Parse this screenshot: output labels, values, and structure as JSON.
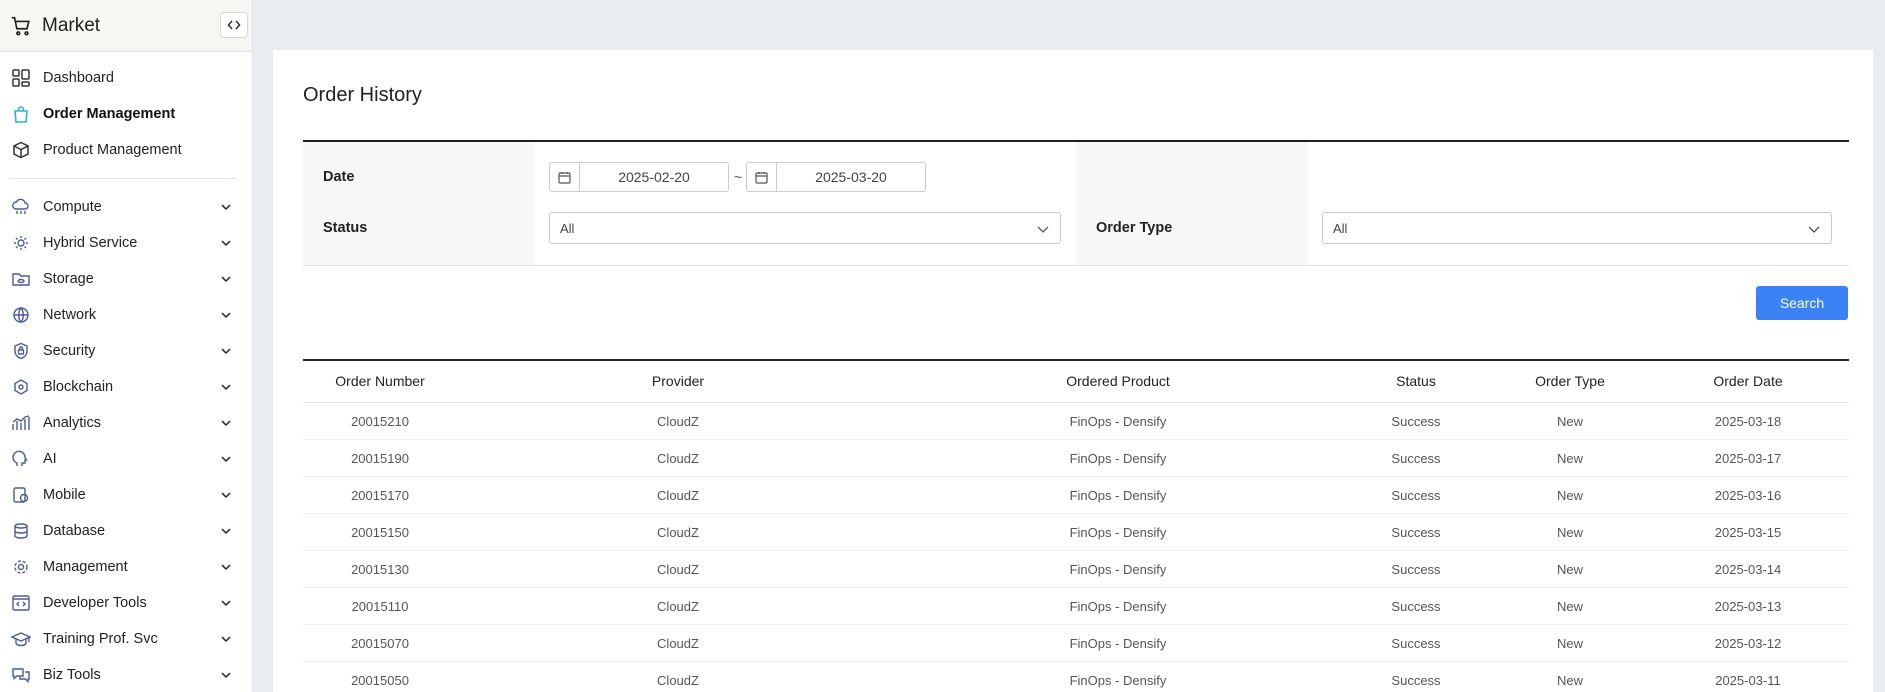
{
  "brand": {
    "title": "Market"
  },
  "nav_top": [
    {
      "label": "Dashboard",
      "icon": "dashboard-grid-icon"
    },
    {
      "label": "Order Management",
      "icon": "shopping-bag-icon",
      "active": true
    },
    {
      "label": "Product Management",
      "icon": "box-icon"
    }
  ],
  "nav_groups": [
    {
      "label": "Compute",
      "icon": "cloud-compute-icon"
    },
    {
      "label": "Hybrid Service",
      "icon": "hybrid-gear-icon"
    },
    {
      "label": "Storage",
      "icon": "storage-icon"
    },
    {
      "label": "Network",
      "icon": "network-icon"
    },
    {
      "label": "Security",
      "icon": "shield-icon"
    },
    {
      "label": "Blockchain",
      "icon": "blockchain-icon"
    },
    {
      "label": "Analytics",
      "icon": "analytics-icon"
    },
    {
      "label": "AI",
      "icon": "ai-head-icon"
    },
    {
      "label": "Mobile",
      "icon": "mobile-icon"
    },
    {
      "label": "Database",
      "icon": "database-icon"
    },
    {
      "label": "Management",
      "icon": "management-gear-icon"
    },
    {
      "label": "Developer Tools",
      "icon": "developer-tools-icon"
    },
    {
      "label": "Training Prof. Svc",
      "icon": "graduation-cap-icon"
    },
    {
      "label": "Biz Tools",
      "icon": "chat-bubbles-icon"
    }
  ],
  "page": {
    "title": "Order History"
  },
  "filter": {
    "date_label": "Date",
    "date_from": "2025-02-20",
    "date_separator": "~",
    "date_to": "2025-03-20",
    "status_label": "Status",
    "status_value": "All",
    "order_type_label": "Order Type",
    "order_type_value": "All",
    "search_label": "Search"
  },
  "table": {
    "headers": [
      "Order Number",
      "Provider",
      "Ordered Product",
      "Status",
      "Order Type",
      "Order Date"
    ],
    "rows": [
      [
        "20015210",
        "CloudZ",
        "FinOps - Densify",
        "Success",
        "New",
        "2025-03-18"
      ],
      [
        "20015190",
        "CloudZ",
        "FinOps - Densify",
        "Success",
        "New",
        "2025-03-17"
      ],
      [
        "20015170",
        "CloudZ",
        "FinOps - Densify",
        "Success",
        "New",
        "2025-03-16"
      ],
      [
        "20015150",
        "CloudZ",
        "FinOps - Densify",
        "Success",
        "New",
        "2025-03-15"
      ],
      [
        "20015130",
        "CloudZ",
        "FinOps - Densify",
        "Success",
        "New",
        "2025-03-14"
      ],
      [
        "20015110",
        "CloudZ",
        "FinOps - Densify",
        "Success",
        "New",
        "2025-03-13"
      ],
      [
        "20015070",
        "CloudZ",
        "FinOps - Densify",
        "Success",
        "New",
        "2025-03-12"
      ],
      [
        "20015050",
        "CloudZ",
        "FinOps - Densify",
        "Success",
        "New",
        "2025-03-11"
      ]
    ]
  },
  "colors": {
    "accent": "#3b82f6",
    "active_icon": "#2bb5c8"
  }
}
